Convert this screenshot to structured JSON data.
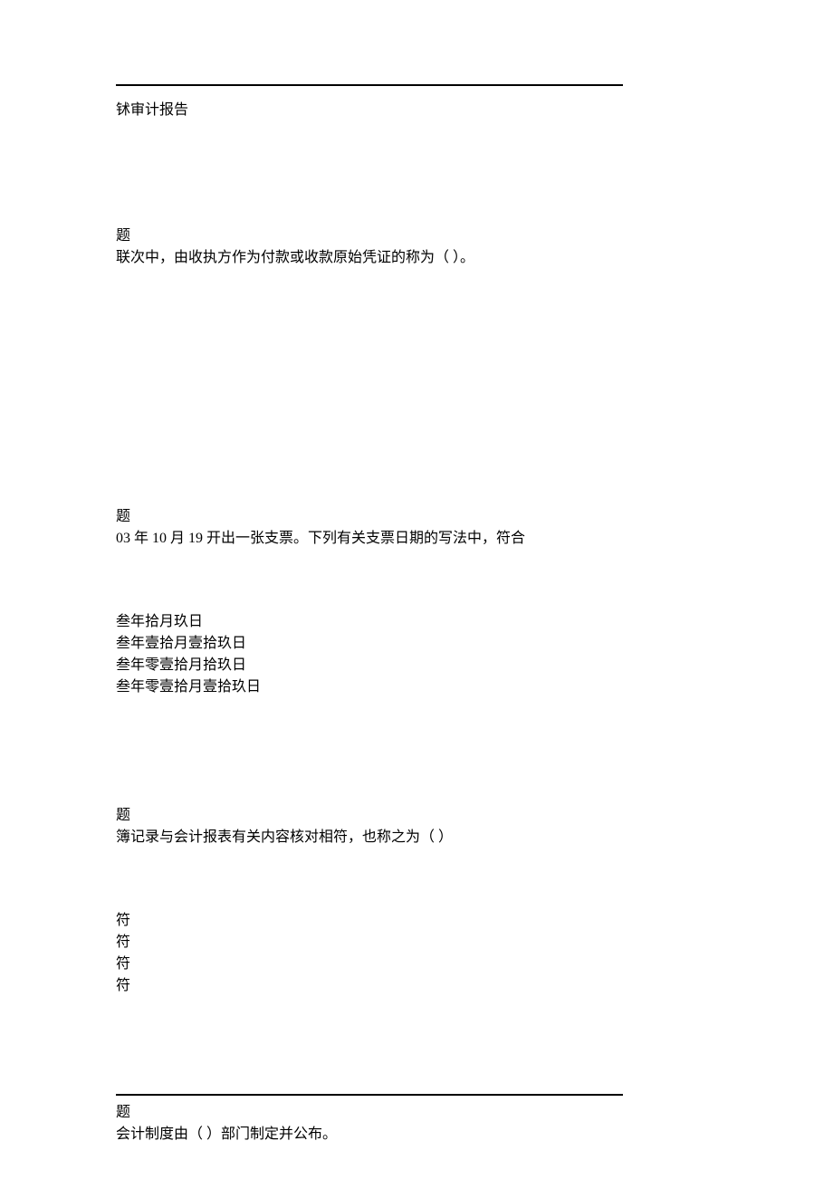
{
  "section1": {
    "line1": "𬬸审计报告"
  },
  "section2": {
    "line1": "题",
    "line2": "联次中，由收执方作为付款或收款原始凭证的称为（  ）。"
  },
  "section3": {
    "line1": "题",
    "line2": "03 年 10 月 19 开出一张支票。下列有关支票日期的写法中，符合",
    "options": {
      "a": "叁年拾月玖日",
      "b": "叁年壹拾月壹拾玖日",
      "c": "叁年零壹拾月拾玖日",
      "d": "叁年零壹拾月壹拾玖日"
    }
  },
  "section4": {
    "line1": "题",
    "line2": "簿记录与会计报表有关内容核对相符，也称之为（  ）",
    "options": {
      "a": "符",
      "b": "符",
      "c": "符",
      "d": "符"
    }
  },
  "section5": {
    "line1": "题",
    "line2": "会计制度由（  ）部门制定并公布。"
  }
}
